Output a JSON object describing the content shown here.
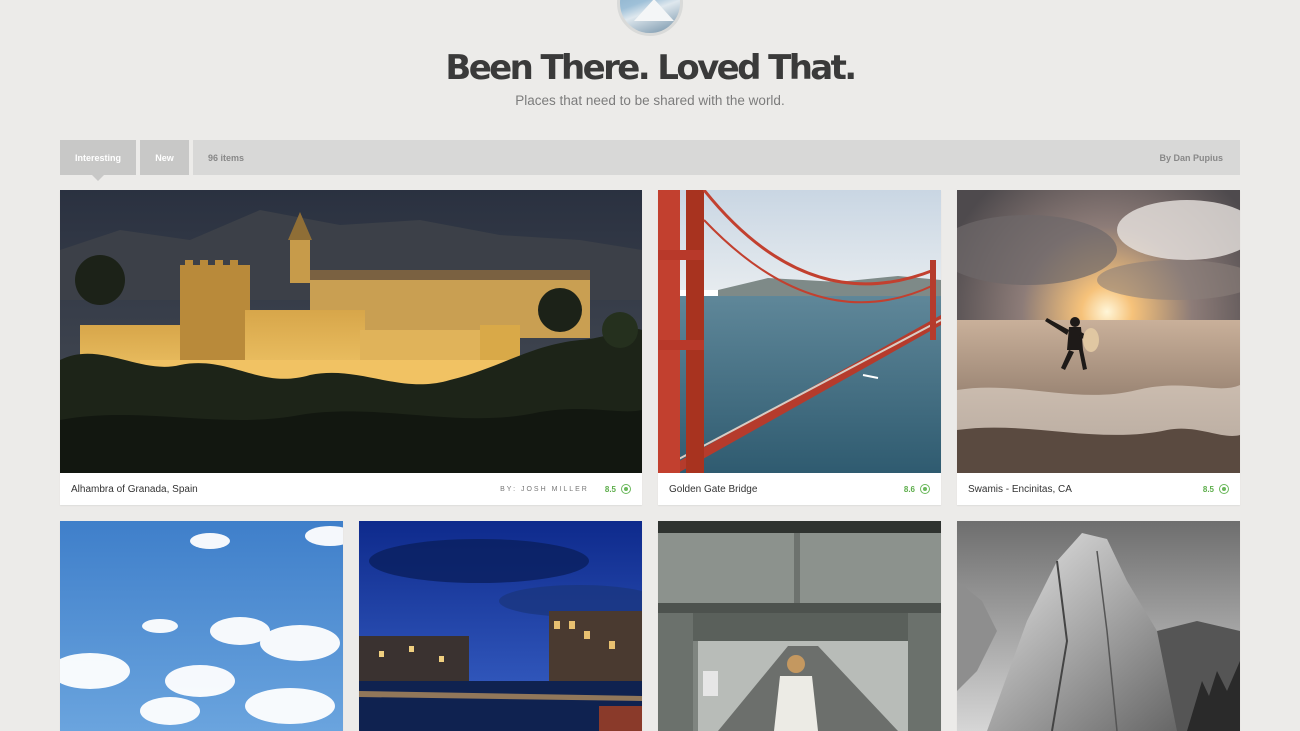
{
  "header": {
    "title": "Been There. Loved That.",
    "tagline": "Places that need to be shared with the world."
  },
  "tabs": [
    {
      "label": "Interesting",
      "active": true
    },
    {
      "label": "New",
      "active": false
    }
  ],
  "toolbar": {
    "item_count": "96 items",
    "author": "By Dan Pupius"
  },
  "cards": [
    {
      "title": "Alhambra of Granada, Spain",
      "by": "BY: JOSH MILLER",
      "score": "8.5",
      "photo": "castle-night"
    },
    {
      "title": "Golden Gate Bridge",
      "by": "",
      "score": "8.6",
      "photo": "bridge"
    },
    {
      "title": "Swamis - Encinitas, CA",
      "by": "",
      "score": "8.5",
      "photo": "surfer-sunset"
    },
    {
      "title": "",
      "by": "",
      "score": "",
      "photo": "clouds-sky"
    },
    {
      "title": "",
      "by": "",
      "score": "",
      "photo": "venice-night"
    },
    {
      "title": "",
      "by": "",
      "score": "",
      "photo": "person-on-bridge"
    },
    {
      "title": "",
      "by": "",
      "score": "",
      "photo": "granite-dome-bw"
    }
  ],
  "colors": {
    "background": "#ecebe9",
    "tab": "#c8c8c7",
    "score_green": "#5cad4a"
  }
}
